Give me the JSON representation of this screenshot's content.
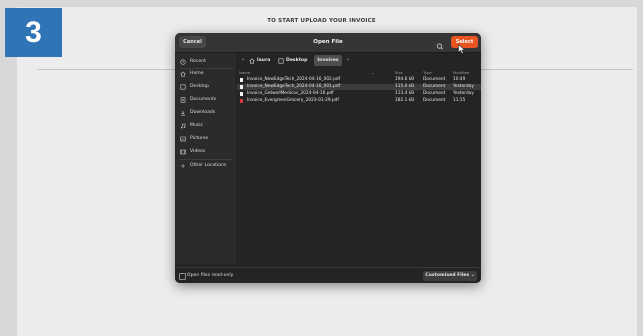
{
  "step_number": "3",
  "page_heading": "TO START UPLOAD YOUR INVOICE",
  "dialog": {
    "title": "Open File",
    "cancel_label": "Cancel",
    "select_label": "Select",
    "search_icon": "search-icon",
    "accent_color": "#e95420",
    "sidebar": [
      {
        "label": "Recent",
        "icon": "clock-icon"
      },
      {
        "label": "Home",
        "icon": "home-icon"
      },
      {
        "label": "Desktop",
        "icon": "desktop-icon"
      },
      {
        "label": "Documents",
        "icon": "document-icon"
      },
      {
        "label": "Downloads",
        "icon": "download-icon"
      },
      {
        "label": "Music",
        "icon": "music-icon"
      },
      {
        "label": "Pictures",
        "icon": "picture-icon"
      },
      {
        "label": "Videos",
        "icon": "video-icon"
      },
      {
        "label": "Other Locations",
        "icon": "plus-icon"
      }
    ],
    "breadcrumb": {
      "back_icon": "chevron-left-icon",
      "forward_icon": "chevron-right-icon",
      "items": [
        {
          "label": "laura",
          "icon": "home-icon"
        },
        {
          "label": "Desktop",
          "icon": "desktop-icon"
        },
        {
          "label": "Invoices"
        }
      ]
    },
    "columns": {
      "name": "Name",
      "size": "Size",
      "type": "Type",
      "modified": "Modified"
    },
    "files": [
      {
        "name": "Invoice_NewEdgeTech_2024-04-16_002.pdf",
        "size": "194.6 kB",
        "type": "Document",
        "modified": "10:49",
        "icon": "file-icon"
      },
      {
        "name": "Invoice_NewEdgeTech_2024-04-16_001.pdf",
        "size": "115.0 kB",
        "type": "Document",
        "modified": "Yesterday",
        "icon": "file-icon"
      },
      {
        "name": "Invoice_GetwellMedicos_2024-04-16.pdf",
        "size": "113.4 kB",
        "type": "Document",
        "modified": "Yesterday",
        "icon": "file-icon"
      },
      {
        "name": "Invoice_EvergreenGrocery_2023-01-29.pdf",
        "size": "182.1 kB",
        "type": "Document",
        "modified": "11:15",
        "icon": "pdf-icon"
      }
    ],
    "read_only_label": "Open files read-only",
    "filter_label": "Customised Files"
  }
}
